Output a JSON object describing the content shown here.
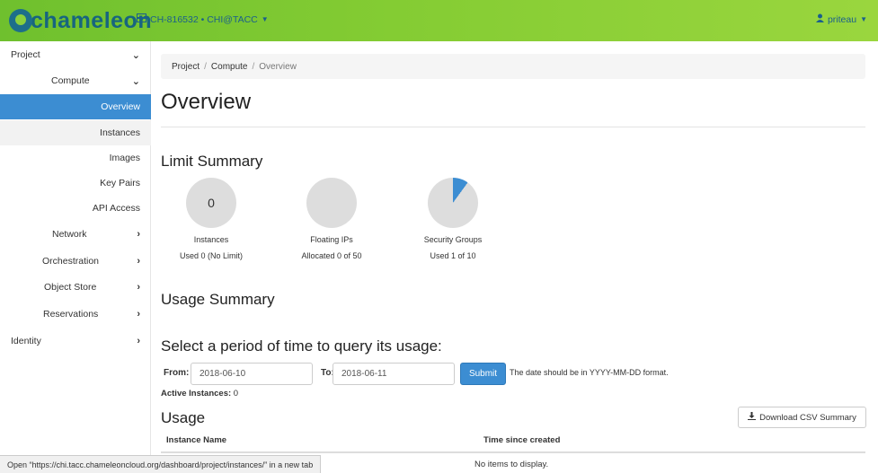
{
  "header": {
    "logo_text": "chameleon",
    "project_selector": "CH-816532 • CHI@TACC",
    "user": "priteau"
  },
  "sidebar": {
    "items": [
      {
        "label": "Project",
        "chevron": "down"
      },
      {
        "label": "Compute",
        "chevron": "down"
      },
      {
        "label": "Overview"
      },
      {
        "label": "Instances"
      },
      {
        "label": "Images"
      },
      {
        "label": "Key Pairs"
      },
      {
        "label": "API Access"
      },
      {
        "label": "Network",
        "chevron": "right"
      },
      {
        "label": "Orchestration",
        "chevron": "right"
      },
      {
        "label": "Object Store",
        "chevron": "right"
      },
      {
        "label": "Reservations",
        "chevron": "right"
      },
      {
        "label": "Identity",
        "chevron": "right"
      }
    ]
  },
  "breadcrumb": [
    "Project",
    "Compute",
    "Overview"
  ],
  "page_title": "Overview",
  "limit_summary": {
    "title": "Limit Summary",
    "charts": [
      {
        "center": "0",
        "label": "Instances",
        "sub": "Used 0 (No Limit)",
        "fraction": 0
      },
      {
        "center": "",
        "label": "Floating IPs",
        "sub": "Allocated 0 of 50",
        "fraction": 0
      },
      {
        "center": "",
        "label": "Security Groups",
        "sub": "Used 1 of 10",
        "fraction": 0.1
      }
    ],
    "fill_color": "#3c8dd2",
    "empty_color": "#dddddd"
  },
  "usage_summary": {
    "title": "Usage Summary",
    "query_title": "Select a period of time to query its usage:",
    "from_label": "From:",
    "from_value": "2018-06-10",
    "to_label": "To:",
    "to_value": "2018-06-11",
    "submit": "Submit",
    "hint": "The date should be in YYYY-MM-DD format.",
    "active_label": "Active Instances:",
    "active_value": "0"
  },
  "usage": {
    "title": "Usage",
    "csv_button": "Download CSV Summary",
    "columns": [
      "Instance Name",
      "Time since created"
    ],
    "empty": "No items to display."
  },
  "statusbar": "Open “https://chi.tacc.chameleoncloud.org/dashboard/project/instances/” in a new tab"
}
